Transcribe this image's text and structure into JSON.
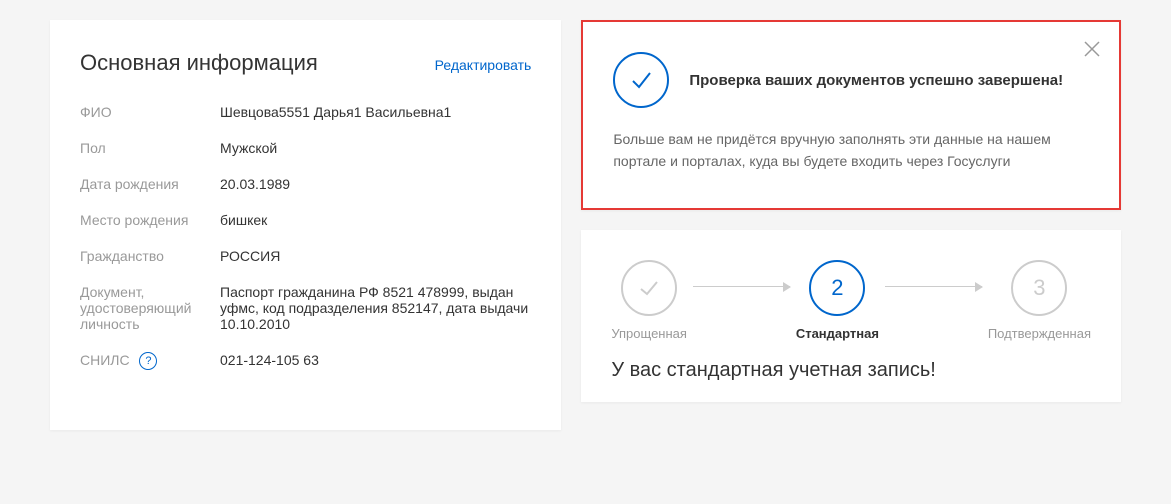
{
  "mainInfo": {
    "title": "Основная информация",
    "editLink": "Редактировать",
    "fields": {
      "fio": {
        "label": "ФИО",
        "value": "Шевцова5551 Дарья1 Васильевна1"
      },
      "gender": {
        "label": "Пол",
        "value": "Мужской"
      },
      "dob": {
        "label": "Дата рождения",
        "value": "20.03.1989"
      },
      "pob": {
        "label": "Место рождения",
        "value": "бишкек"
      },
      "citizenship": {
        "label": "Гражданство",
        "value": "РОССИЯ"
      },
      "idDoc": {
        "label": "Документ, удостоверяющий личность",
        "value": "Паспорт гражданина РФ 8521 478999, выдан уфмс, код подразделения 852147, дата выдачи 10.10.2010"
      },
      "snils": {
        "label": "СНИЛС",
        "value": "021-124-105 63",
        "help": "?"
      }
    }
  },
  "notification": {
    "title": "Проверка ваших документов успешно завершена!",
    "body": "Больше вам не придётся вручную заполнять эти данные на нашем портале и порталах, куда вы будете входить через Госуслуги"
  },
  "steps": {
    "step1": {
      "label": "Упрощенная"
    },
    "step2": {
      "number": "2",
      "label": "Стандартная"
    },
    "step3": {
      "number": "3",
      "label": "Подтвержденная"
    },
    "statusTitle": "У вас стандартная учетная запись!"
  }
}
